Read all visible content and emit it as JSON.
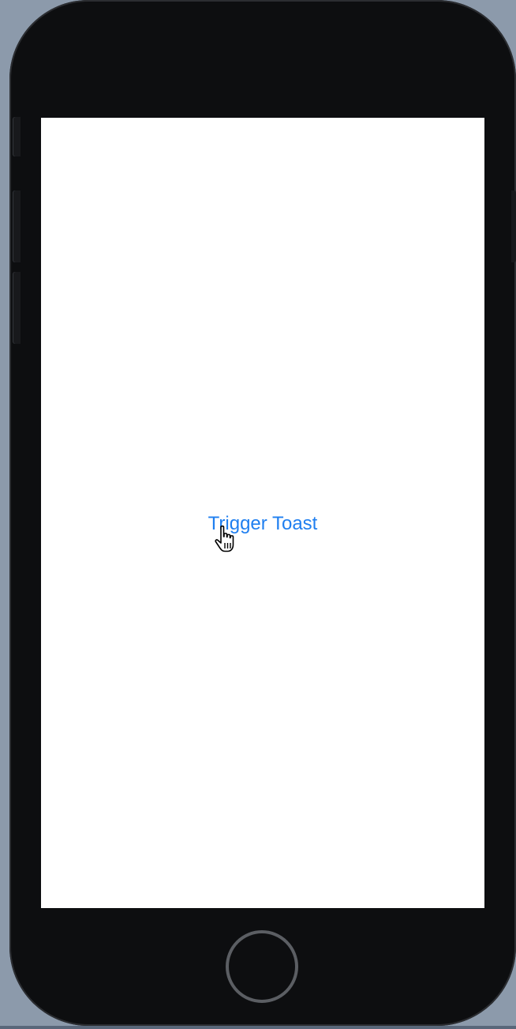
{
  "app": {
    "trigger_button_label": "Trigger Toast"
  },
  "icons": {
    "cursor": "hand-pointer-cursor-icon",
    "home_button": "home-button"
  },
  "colors": {
    "button_text": "#1f7ff0",
    "screen_background": "#ffffff",
    "device_body": "#0d0e10",
    "desktop_background": "#8c9aab"
  }
}
